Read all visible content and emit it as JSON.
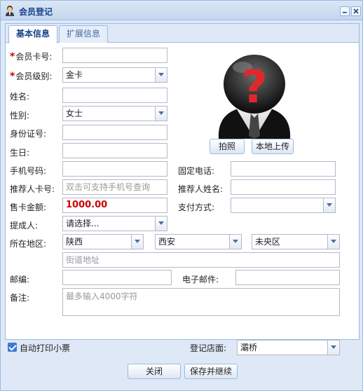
{
  "window": {
    "title": "会员登记"
  },
  "tabs": [
    {
      "label": "基本信息",
      "active": true
    },
    {
      "label": "扩展信息",
      "active": false
    }
  ],
  "form": {
    "card_no_label": "会员卡号:",
    "card_no_value": "",
    "level_label": "会员级别:",
    "level_value": "金卡",
    "name_label": "姓名:",
    "name_value": "",
    "gender_label": "性别:",
    "gender_value": "女士",
    "id_label": "身份证号:",
    "id_value": "",
    "birthday_label": "生日:",
    "birthday_value": "",
    "mobile_label": "手机号码:",
    "mobile_value": "",
    "phone_label": "固定电话:",
    "phone_value": "",
    "referrer_card_label": "推荐人卡号:",
    "referrer_card_placeholder": "双击可支持手机号查询",
    "referrer_name_label": "推荐人姓名:",
    "referrer_name_value": "",
    "amount_label": "售卡金额:",
    "amount_value": "1000.00",
    "payment_label": "支付方式:",
    "payment_value": "",
    "commission_label": "提成人:",
    "commission_value": "请选择...",
    "region_label": "所在地区:",
    "province_value": "陕西",
    "city_value": "西安",
    "district_value": "未央区",
    "street_placeholder": "街道地址",
    "postcode_label": "邮编:",
    "postcode_value": "",
    "email_label": "电子邮件:",
    "email_value": "",
    "remark_label": "备注:",
    "remark_placeholder": "最多输入4000字符"
  },
  "photo": {
    "capture_label": "拍照",
    "upload_label": "本地上传"
  },
  "footer": {
    "auto_print_label": "自动打印小票",
    "auto_print_checked": true,
    "store_label": "登记店面:",
    "store_value": "灞桥",
    "close_label": "关闭",
    "save_label": "保存并继续"
  },
  "colors": {
    "title_text": "#15428b",
    "required_mark": "#cc0000",
    "amount_text": "#cc0000",
    "avatar_question": "#e0282c"
  },
  "icons": {
    "title": "member-icon",
    "minimize": "minimize-icon",
    "close": "close-icon",
    "avatar": "unknown-person-icon"
  }
}
